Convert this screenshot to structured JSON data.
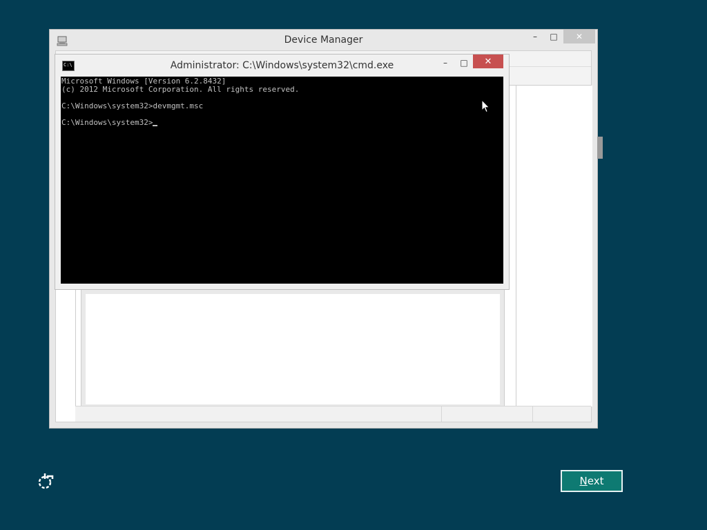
{
  "device_manager": {
    "title": "Device Manager",
    "controls": {
      "minimize": "–",
      "maximize": "□",
      "close": "✕"
    }
  },
  "cmd": {
    "title": "Administrator: C:\\Windows\\system32\\cmd.exe",
    "icon_text": "C:\\",
    "controls": {
      "minimize": "–",
      "maximize": "□",
      "close": "✕"
    },
    "lines": [
      "Microsoft Windows [Version 6.2.8432]",
      "(c) 2012 Microsoft Corporation. All rights reserved.",
      "",
      "C:\\Windows\\system32>devmgmt.msc",
      "",
      "C:\\Windows\\system32>"
    ]
  },
  "next_button": {
    "accesskey": "N",
    "rest": "ext"
  },
  "icons": {
    "dm_app": "device-manager-icon",
    "cmd_app": "cmd-icon",
    "repair": "repair-icon",
    "pointer": "mouse-pointer-icon"
  },
  "colors": {
    "desktop": "#033d53",
    "next_button": "#0e7a72",
    "close_active": "#c75050"
  }
}
